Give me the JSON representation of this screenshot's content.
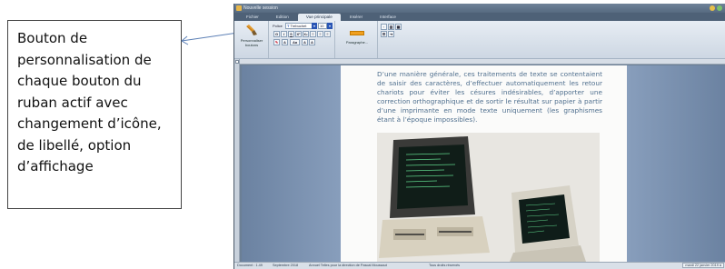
{
  "callout": {
    "lines": [
      "Bouton de",
      "personnalisation de",
      "chaque bouton du",
      "ruban actif avec",
      "changement d’icône,",
      "de libellé, option",
      "d’affichage"
    ]
  },
  "window": {
    "title": "Nouvelle session",
    "tabs": [
      "Fichier",
      "Edition",
      "Vue principale",
      "Insérer",
      "Interface"
    ],
    "active_tab": "Vue principale"
  },
  "ribbon": {
    "customize": {
      "label_line1": "Personnaliser",
      "label_line2": "boutons",
      "icon": "brush-icon"
    },
    "font_group": {
      "police_label": "Police",
      "font_name": "Trebuchet",
      "font_size": "10",
      "format_buttons": [
        "G",
        "I",
        "S",
        "X²",
        "X₂"
      ],
      "row3": [
        "A",
        "Aa",
        "A"
      ],
      "label": ""
    },
    "paragraph": {
      "label": "Paragraphe..."
    }
  },
  "document": {
    "paragraph_text": "D’une manière générale, ces traitements de texte se contentaient de saisir des caractères, d’effectuer automatiquement les retour chariots pour éviter les césures indésirables, d’apporter une correction orthographique et de sortir le résultat sur papier à partir d’une imprimante en mode texte uniquement (les graphismes étant à l’époque impossibles)."
  },
  "status": {
    "items": [
      "Document : 1.49",
      "Septembre 2018",
      "Annuel Telles pour la direction de Pascal Moussaut",
      "Tous droits réservés"
    ],
    "datetime": "mardi 22 janvier 2019 à"
  },
  "colors": {
    "accent": "#2a56b5",
    "text_blue": "#4f6f8e",
    "brush_orange": "#e39a2d"
  }
}
